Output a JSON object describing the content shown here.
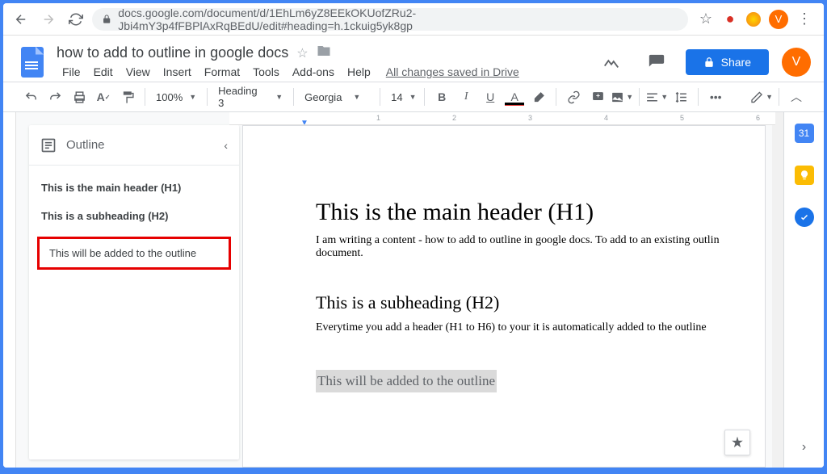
{
  "browser": {
    "url": "docs.google.com/document/d/1EhLm6yZ8EEkOKUofZRu2-Jbi4mY3p4fFBPlAxRqBEdU/edit#heading=h.1ckuig5yk8gp",
    "avatar_letter": "V"
  },
  "header": {
    "doc_title": "how to add to outline in google docs",
    "menus": [
      "File",
      "Edit",
      "View",
      "Insert",
      "Format",
      "Tools",
      "Add-ons",
      "Help"
    ],
    "save_status": "All changes saved in Drive",
    "share_label": "Share",
    "avatar_letter": "V"
  },
  "toolbar": {
    "zoom": "100%",
    "style": "Heading 3",
    "font": "Georgia",
    "font_size": "14",
    "ruler_ticks": [
      "1",
      "2",
      "3",
      "4",
      "5",
      "6"
    ]
  },
  "outline": {
    "title": "Outline",
    "items": [
      {
        "label": "This is the main header (H1)",
        "bold": true
      },
      {
        "label": "This is a subheading (H2)",
        "bold": true
      },
      {
        "label": "This will be added to the outline",
        "highlighted": true
      }
    ]
  },
  "document": {
    "h1": "This is the main header (H1)",
    "p1": "I am writing a content - how to add to outline in google docs. To add to an existing outlin document.",
    "h2": "This is a subheading (H2)",
    "p2": "Everytime you add a header (H1 to H6) to your it is automatically added to the outline",
    "h3": "This will be added to the outline"
  },
  "side_apps": {
    "calendar": "31"
  }
}
